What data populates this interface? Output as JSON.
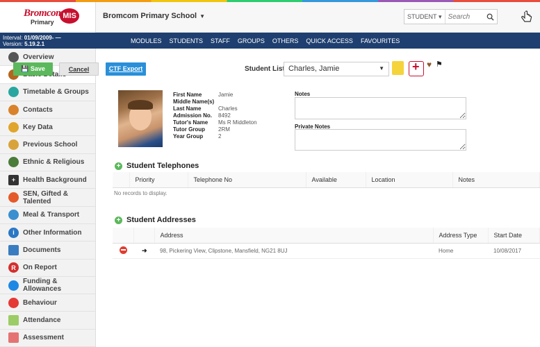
{
  "header": {
    "logo_text": "Bromcom",
    "logo_sub": "Primary",
    "logo_badge": "MIS",
    "school_name": "Bromcom Primary School",
    "search_scope": "STUDENT",
    "search_placeholder": "Search"
  },
  "info": {
    "interval_label": "Interval:",
    "interval_value": "01/09/2009- —",
    "version_label": "Version:",
    "version_value": "5.19.2.1"
  },
  "topnav": [
    "MODULES",
    "STUDENTS",
    "STAFF",
    "GROUPS",
    "OTHERS",
    "QUICK ACCESS",
    "FAVOURITES"
  ],
  "sidebar": {
    "items": [
      {
        "label": "Overview",
        "icon": "overview-icon",
        "color": "#555555"
      },
      {
        "label": "Basic Details",
        "icon": "person-icon",
        "color": "#b5651d"
      },
      {
        "label": "Timetable & Groups",
        "icon": "timetable-icon",
        "color": "#2aa6a0"
      },
      {
        "label": "Contacts",
        "icon": "contacts-icon",
        "color": "#d9822b"
      },
      {
        "label": "Key Data",
        "icon": "key-icon",
        "color": "#e0a52c"
      },
      {
        "label": "Previous School",
        "icon": "school-icon",
        "color": "#d9a33b"
      },
      {
        "label": "Ethnic & Religious",
        "icon": "globe-icon",
        "color": "#4a7c3a"
      },
      {
        "label": "Health Background",
        "icon": "health-icon",
        "color": "#333333"
      },
      {
        "label": "SEN, Gifted & Talented",
        "icon": "lifebuoy-icon",
        "color": "#e55a2b"
      },
      {
        "label": "Meal & Transport",
        "icon": "meal-icon",
        "color": "#3a8fd0"
      },
      {
        "label": "Other Information",
        "icon": "info-icon",
        "color": "#2a77c5"
      },
      {
        "label": "Documents",
        "icon": "document-icon",
        "color": "#3a7cc0"
      },
      {
        "label": "On Report",
        "icon": "report-icon",
        "color": "#d32f2f"
      },
      {
        "label": "Funding & Allowances",
        "icon": "funding-icon",
        "color": "#1e88e5"
      },
      {
        "label": "Behaviour",
        "icon": "behaviour-icon",
        "color": "#e53935"
      },
      {
        "label": "Attendance",
        "icon": "attendance-icon",
        "color": "#9ccc65"
      },
      {
        "label": "Assessment",
        "icon": "assessment-icon",
        "color": "#e57373"
      }
    ]
  },
  "toolbar": {
    "save_label": "Save",
    "cancel_label": "Cancel",
    "ctf_label": "CTF Export",
    "student_list_label": "Student List:",
    "student_selected": "Charles, Jamie"
  },
  "student": {
    "fields": [
      {
        "label": "First Name",
        "value": "Jamie"
      },
      {
        "label": "Middle Name(s)",
        "value": ""
      },
      {
        "label": "Last Name",
        "value": "Charles"
      },
      {
        "label": "Admission No.",
        "value": "8492"
      },
      {
        "label": "Tutor's Name",
        "value": "Ms R Middleton"
      },
      {
        "label": "Tutor Group",
        "value": "2RM"
      },
      {
        "label": "Year Group",
        "value": "2"
      }
    ]
  },
  "notes": {
    "label": "Notes",
    "private_label": "Private Notes"
  },
  "telephones": {
    "title": "Student Telephones",
    "columns": [
      "Priority",
      "Telephone No",
      "Available",
      "Location",
      "Notes"
    ],
    "empty_text": "No records to display."
  },
  "addresses": {
    "title": "Student Addresses",
    "columns": [
      "Address",
      "Address Type",
      "Start Date"
    ],
    "rows": [
      {
        "address": "98, Pickering View, Clipstone, Mansfield, NG21 8UJ",
        "type": "Home",
        "start_date": "10/08/2017"
      }
    ]
  }
}
